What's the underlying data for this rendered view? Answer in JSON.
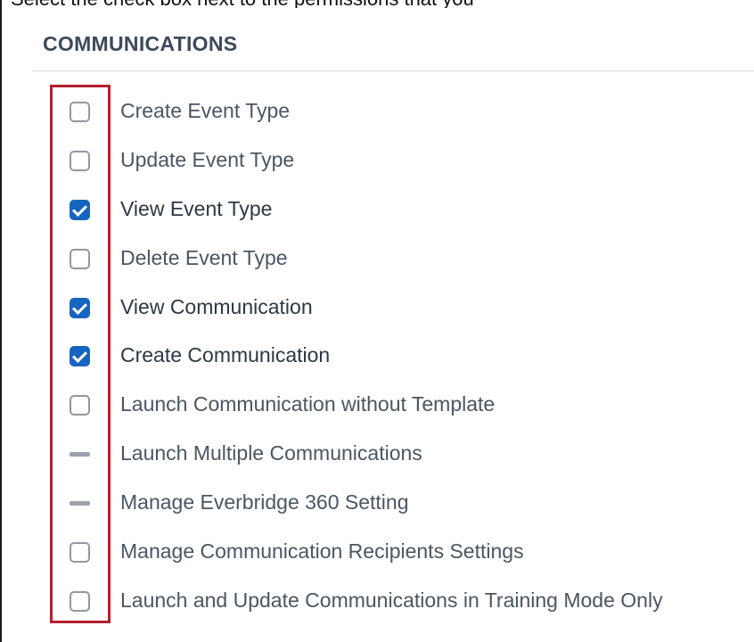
{
  "header": {
    "partial_text": "Select the check box next to the permissions that you",
    "section_title": "COMMUNICATIONS"
  },
  "permissions": [
    {
      "label": "Create Event Type",
      "state": "unchecked"
    },
    {
      "label": "Update Event Type",
      "state": "unchecked"
    },
    {
      "label": "View Event Type",
      "state": "checked"
    },
    {
      "label": "Delete Event Type",
      "state": "unchecked"
    },
    {
      "label": "View Communication",
      "state": "checked"
    },
    {
      "label": "Create Communication",
      "state": "checked"
    },
    {
      "label": "Launch Communication without Template",
      "state": "unchecked"
    },
    {
      "label": "Launch Multiple Communications",
      "state": "indeterminate"
    },
    {
      "label": "Manage Everbridge 360 Setting",
      "state": "indeterminate"
    },
    {
      "label": "Manage Communication Recipients Settings",
      "state": "unchecked"
    },
    {
      "label": "Launch and Update Communications in Training Mode Only",
      "state": "unchecked"
    }
  ],
  "colors": {
    "checked_fill": "#1565c0",
    "highlight_border": "#b3202c",
    "title_text": "#3d4a5a"
  }
}
